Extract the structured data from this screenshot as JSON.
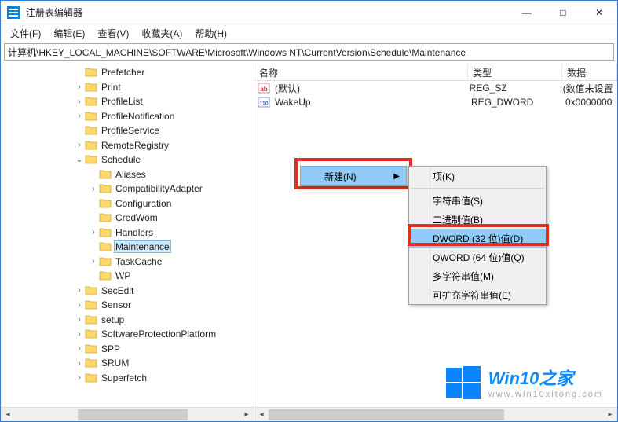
{
  "window": {
    "title": "注册表编辑器",
    "minimize": "—",
    "maximize": "□",
    "close": "✕"
  },
  "menu": {
    "file": "文件(F)",
    "edit": "编辑(E)",
    "view": "查看(V)",
    "favorites": "收藏夹(A)",
    "help": "帮助(H)"
  },
  "address": "计算机\\HKEY_LOCAL_MACHINE\\SOFTWARE\\Microsoft\\Windows NT\\CurrentVersion\\Schedule\\Maintenance",
  "tree": [
    {
      "label": "Prefetcher",
      "indent": 3,
      "exp": ""
    },
    {
      "label": "Print",
      "indent": 3,
      "exp": ">"
    },
    {
      "label": "ProfileList",
      "indent": 3,
      "exp": ">"
    },
    {
      "label": "ProfileNotification",
      "indent": 3,
      "exp": ">"
    },
    {
      "label": "ProfileService",
      "indent": 3,
      "exp": ""
    },
    {
      "label": "RemoteRegistry",
      "indent": 3,
      "exp": ">"
    },
    {
      "label": "Schedule",
      "indent": 3,
      "exp": "v"
    },
    {
      "label": "Aliases",
      "indent": 4,
      "exp": ""
    },
    {
      "label": "CompatibilityAdapter",
      "indent": 4,
      "exp": ">"
    },
    {
      "label": "Configuration",
      "indent": 4,
      "exp": ""
    },
    {
      "label": "CredWom",
      "indent": 4,
      "exp": ""
    },
    {
      "label": "Handlers",
      "indent": 4,
      "exp": ">"
    },
    {
      "label": "Maintenance",
      "indent": 4,
      "exp": "",
      "selected": true
    },
    {
      "label": "TaskCache",
      "indent": 4,
      "exp": ">"
    },
    {
      "label": "WP",
      "indent": 4,
      "exp": ""
    },
    {
      "label": "SecEdit",
      "indent": 3,
      "exp": ">"
    },
    {
      "label": "Sensor",
      "indent": 3,
      "exp": ">"
    },
    {
      "label": "setup",
      "indent": 3,
      "exp": ">"
    },
    {
      "label": "SoftwareProtectionPlatform",
      "indent": 3,
      "exp": ">"
    },
    {
      "label": "SPP",
      "indent": 3,
      "exp": ">"
    },
    {
      "label": "SRUM",
      "indent": 3,
      "exp": ">"
    },
    {
      "label": "Superfetch",
      "indent": 3,
      "exp": ">"
    }
  ],
  "columns": {
    "name": "名称",
    "type": "类型",
    "data": "数据"
  },
  "values": [
    {
      "name": "(默认)",
      "type": "REG_SZ",
      "data": "(数值未设置",
      "icon": "string"
    },
    {
      "name": "WakeUp",
      "type": "REG_DWORD",
      "data": "0x0000000",
      "icon": "binary"
    }
  ],
  "context1": {
    "new": "新建(N)"
  },
  "context2": {
    "key": "项(K)",
    "string": "字符串值(S)",
    "binary": "二进制值(B)",
    "dword": "DWORD (32 位)值(D)",
    "qword": "QWORD (64 位)值(Q)",
    "multisz": "多字符串值(M)",
    "expandsz": "可扩充字符串值(E)"
  },
  "watermark": {
    "brand": "Win10之家",
    "url": "www.win10xitong.com"
  }
}
